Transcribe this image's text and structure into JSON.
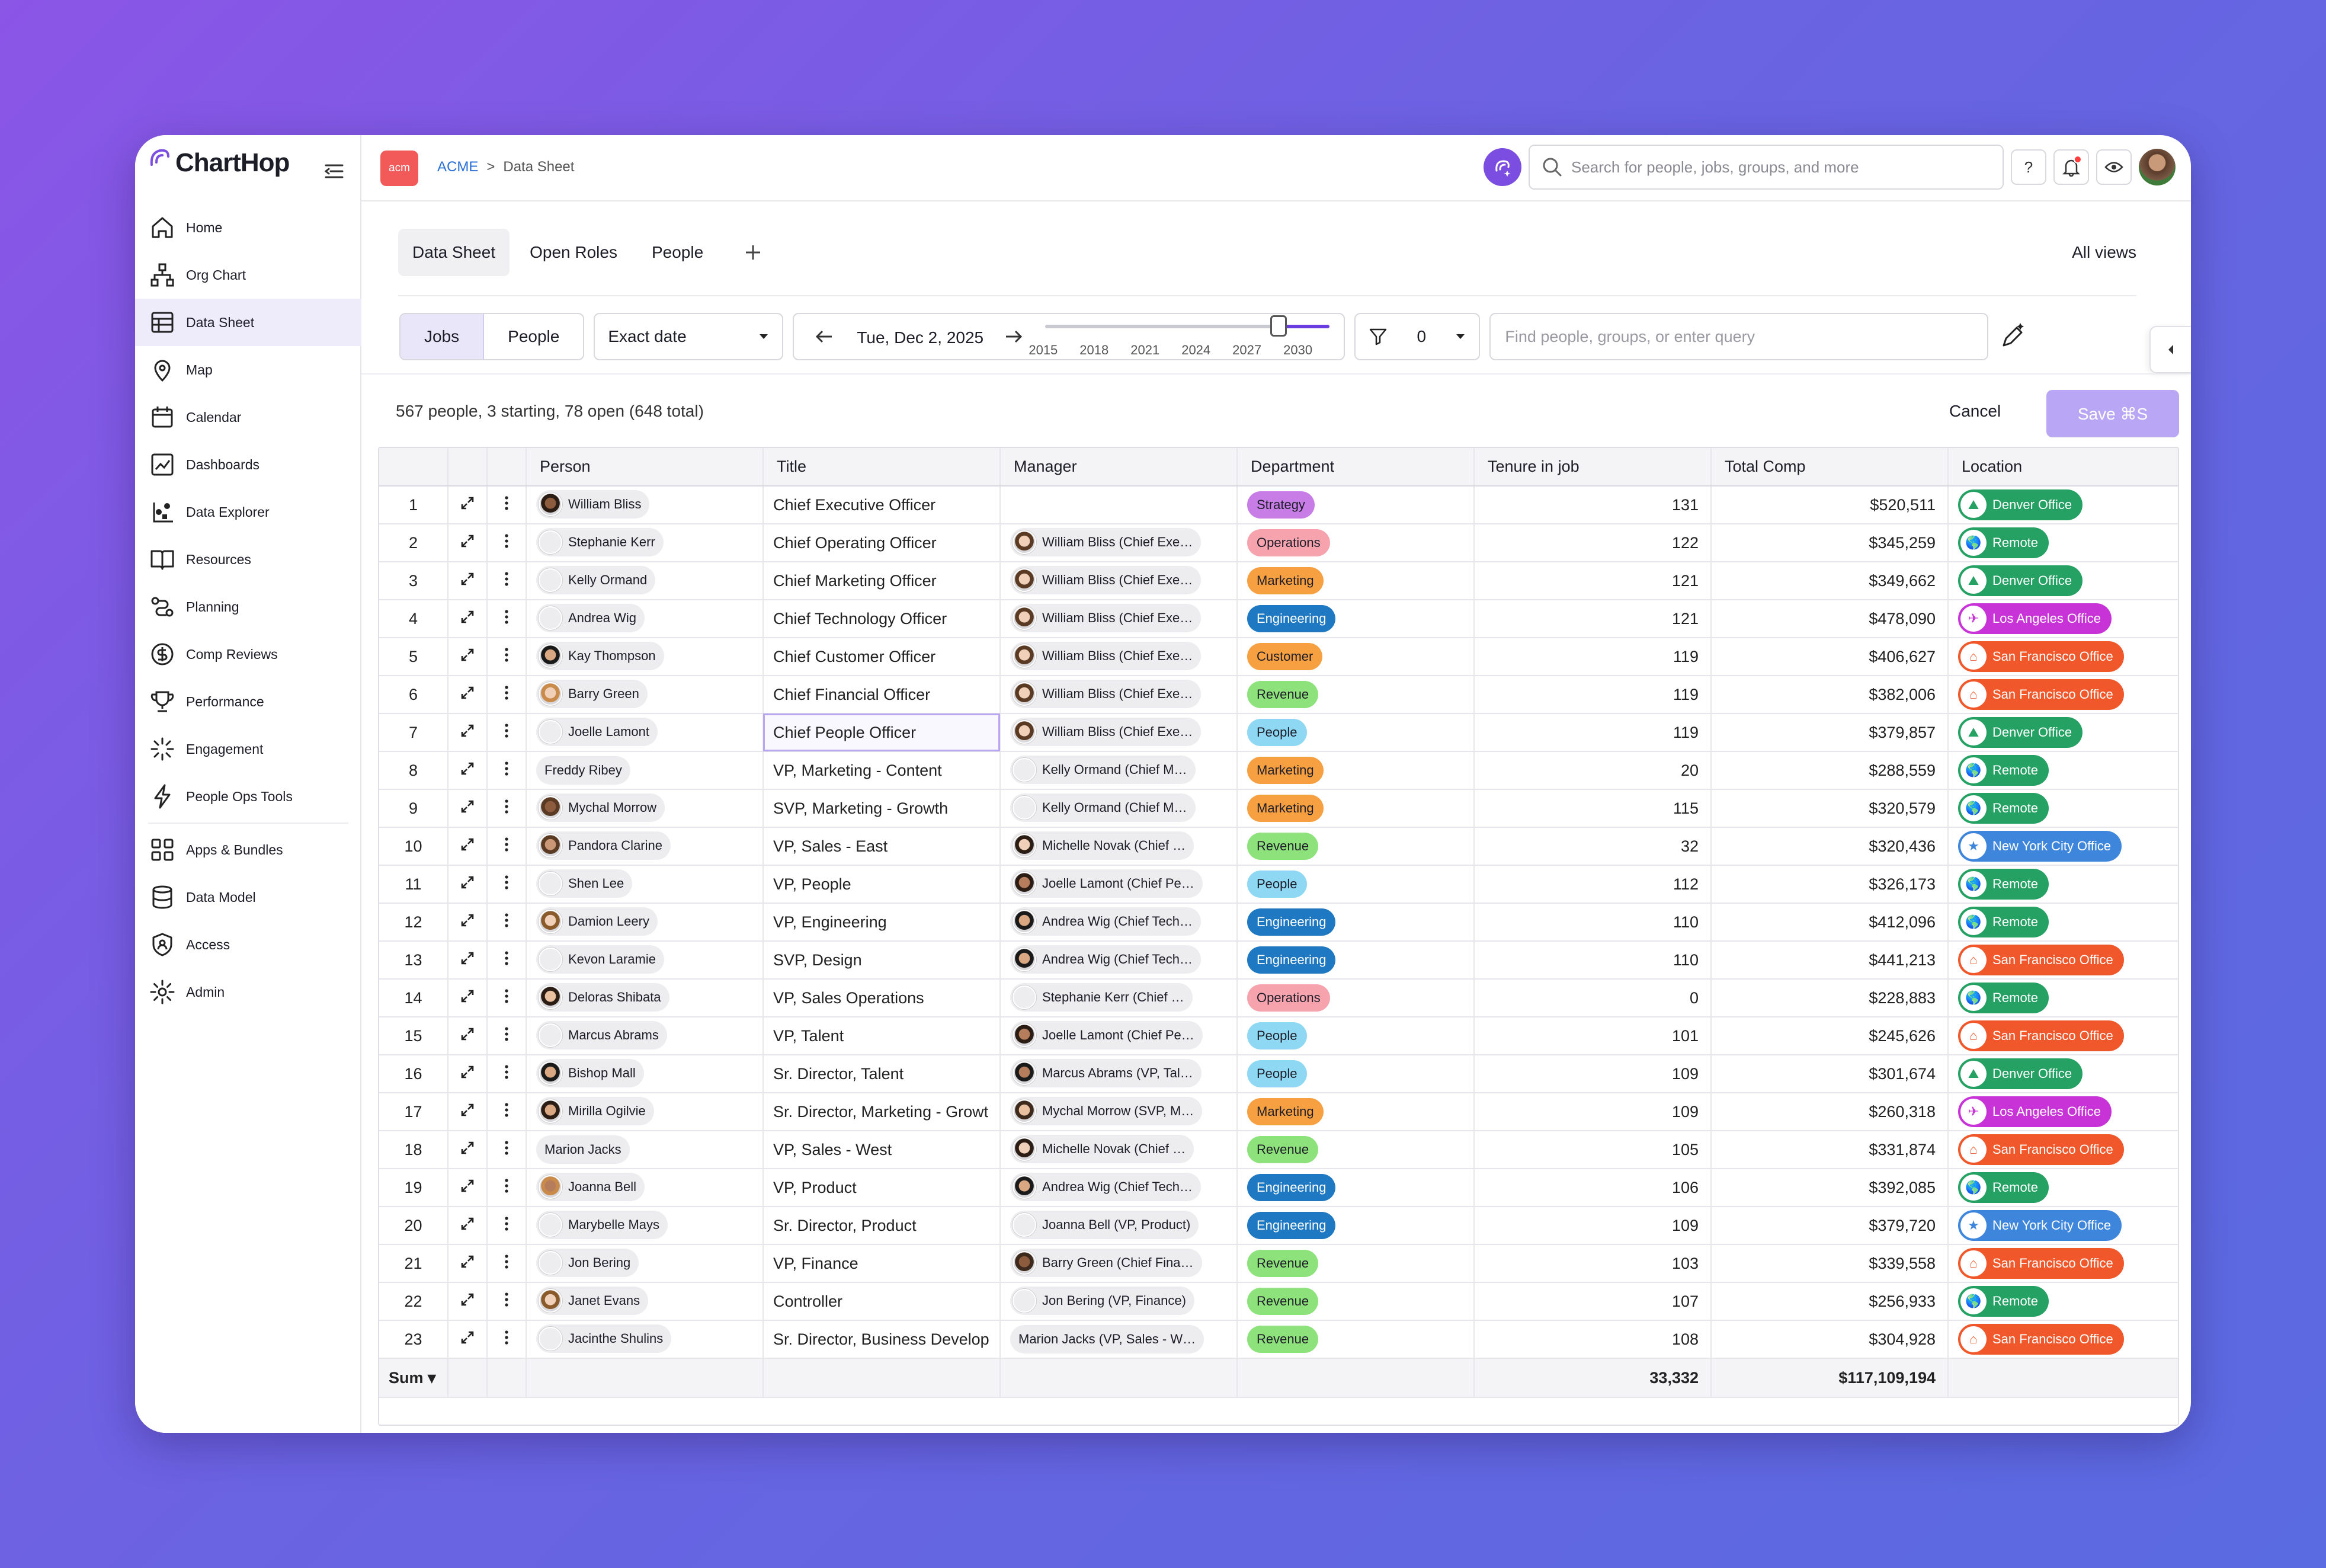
{
  "app": {
    "logo": "ChartHop"
  },
  "nav": [
    {
      "label": "Home",
      "icon": "home-icon"
    },
    {
      "label": "Org Chart",
      "icon": "org-chart-icon"
    },
    {
      "label": "Data Sheet",
      "icon": "table-icon",
      "active": true
    },
    {
      "label": "Map",
      "icon": "map-pin-icon"
    },
    {
      "label": "Calendar",
      "icon": "calendar-icon"
    },
    {
      "label": "Dashboards",
      "icon": "dashboard-icon"
    },
    {
      "label": "Data Explorer",
      "icon": "data-explorer-icon"
    },
    {
      "label": "Resources",
      "icon": "book-icon"
    },
    {
      "label": "Planning",
      "icon": "planning-icon"
    },
    {
      "label": "Comp Reviews",
      "icon": "dollar-icon"
    },
    {
      "label": "Performance",
      "icon": "trophy-icon"
    },
    {
      "label": "Engagement",
      "icon": "spark-icon"
    },
    {
      "label": "People Ops Tools",
      "icon": "bolt-icon"
    },
    {
      "label": "Apps & Bundles",
      "icon": "apps-icon"
    },
    {
      "label": "Data Model",
      "icon": "database-icon"
    },
    {
      "label": "Access",
      "icon": "shield-icon"
    },
    {
      "label": "Admin",
      "icon": "gear-icon"
    }
  ],
  "topbar": {
    "org_badge": "acm",
    "breadcrumb": [
      "ACME",
      ">",
      "Data Sheet"
    ],
    "search_placeholder": "Search for people, jobs, groups, and more",
    "help": "?"
  },
  "tabs": [
    "Data Sheet",
    "Open Roles",
    "People"
  ],
  "all_views": "All views",
  "filters": {
    "entity": [
      "Jobs",
      "People"
    ],
    "date_mode": "Exact date",
    "date": "Tue, Dec 2, 2025",
    "timeline_years": [
      "2015",
      "2018",
      "2021",
      "2024",
      "2027",
      "2030"
    ],
    "timeline_fraction": 0.82,
    "filter_count": "0",
    "query_placeholder": "Find people, groups, or enter query"
  },
  "summary": "567 people, 3 starting, 78 open (648 total)",
  "cancel": "Cancel",
  "save": "Save ⌘S",
  "columns": [
    "Person",
    "Title",
    "Manager",
    "Department",
    "Tenure in job",
    "Total Comp",
    "Location"
  ],
  "dept_colors": {
    "Strategy": "#c77ce6",
    "Operations": "#f6a3ad",
    "Marketing": "#f7a042",
    "Engineering": "#1f78c2",
    "Customer": "#f7a042",
    "Revenue": "#8ee27b",
    "People": "#8fd8f3"
  },
  "location_colors": {
    "Denver Office": "#25a163",
    "Remote": "#25a163",
    "Los Angeles Office": "#c733d6",
    "San Francisco Office": "#f0572a",
    "New York City Office": "#3e86dc"
  },
  "rows": [
    {
      "n": "1",
      "person": "William Bliss",
      "title": "Chief Executive Officer",
      "manager": "",
      "dept": "Strategy",
      "tenure": "131",
      "comp": "$520,511",
      "loc": "Denver Office"
    },
    {
      "n": "2",
      "person": "Stephanie Kerr",
      "title": "Chief Operating Officer",
      "manager": "William Bliss (Chief Exe…",
      "dept": "Operations",
      "tenure": "122",
      "comp": "$345,259",
      "loc": "Remote"
    },
    {
      "n": "3",
      "person": "Kelly Ormand",
      "title": "Chief Marketing Officer",
      "manager": "William Bliss (Chief Exe…",
      "dept": "Marketing",
      "tenure": "121",
      "comp": "$349,662",
      "loc": "Denver Office"
    },
    {
      "n": "4",
      "person": "Andrea Wig",
      "title": "Chief Technology Officer",
      "manager": "William Bliss (Chief Exe…",
      "dept": "Engineering",
      "tenure": "121",
      "comp": "$478,090",
      "loc": "Los Angeles Office"
    },
    {
      "n": "5",
      "person": "Kay Thompson",
      "title": "Chief Customer Officer",
      "manager": "William Bliss (Chief Exe…",
      "dept": "Customer",
      "tenure": "119",
      "comp": "$406,627",
      "loc": "San Francisco Office"
    },
    {
      "n": "6",
      "person": "Barry Green",
      "title": "Chief Financial Officer",
      "manager": "William Bliss (Chief Exe…",
      "dept": "Revenue",
      "tenure": "119",
      "comp": "$382,006",
      "loc": "San Francisco Office"
    },
    {
      "n": "7",
      "person": "Joelle Lamont",
      "title": "Chief People Officer",
      "manager": "William Bliss (Chief Exe…",
      "dept": "People",
      "tenure": "119",
      "comp": "$379,857",
      "loc": "Denver Office",
      "selected": true
    },
    {
      "n": "8",
      "person": "Freddy Ribey",
      "title": "VP, Marketing - Content",
      "manager": "Kelly Ormand (Chief M…",
      "dept": "Marketing",
      "tenure": "20",
      "comp": "$288,559",
      "loc": "Remote",
      "noavatar": true
    },
    {
      "n": "9",
      "person": "Mychal Morrow",
      "title": "SVP, Marketing - Growth",
      "manager": "Kelly Ormand (Chief M…",
      "dept": "Marketing",
      "tenure": "115",
      "comp": "$320,579",
      "loc": "Remote"
    },
    {
      "n": "10",
      "person": "Pandora Clarine",
      "title": "VP, Sales - East",
      "manager": "Michelle Novak (Chief …",
      "dept": "Revenue",
      "tenure": "32",
      "comp": "$320,436",
      "loc": "New York City Office"
    },
    {
      "n": "11",
      "person": "Shen Lee",
      "title": "VP, People",
      "manager": "Joelle Lamont (Chief Pe…",
      "dept": "People",
      "tenure": "112",
      "comp": "$326,173",
      "loc": "Remote"
    },
    {
      "n": "12",
      "person": "Damion Leery",
      "title": "VP, Engineering",
      "manager": "Andrea Wig (Chief Tech…",
      "dept": "Engineering",
      "tenure": "110",
      "comp": "$412,096",
      "loc": "Remote"
    },
    {
      "n": "13",
      "person": "Kevon Laramie",
      "title": "SVP, Design",
      "manager": "Andrea Wig (Chief Tech…",
      "dept": "Engineering",
      "tenure": "110",
      "comp": "$441,213",
      "loc": "San Francisco Office"
    },
    {
      "n": "14",
      "person": "Deloras Shibata",
      "title": "VP, Sales Operations",
      "manager": "Stephanie Kerr (Chief …",
      "dept": "Operations",
      "tenure": "0",
      "comp": "$228,883",
      "loc": "Remote"
    },
    {
      "n": "15",
      "person": "Marcus Abrams",
      "title": "VP, Talent",
      "manager": "Joelle Lamont (Chief Pe…",
      "dept": "People",
      "tenure": "101",
      "comp": "$245,626",
      "loc": "San Francisco Office"
    },
    {
      "n": "16",
      "person": "Bishop Mall",
      "title": "Sr. Director, Talent",
      "manager": "Marcus Abrams (VP, Tal…",
      "dept": "People",
      "tenure": "109",
      "comp": "$301,674",
      "loc": "Denver Office"
    },
    {
      "n": "17",
      "person": "Mirilla Ogilvie",
      "title": "Sr. Director, Marketing - Growt",
      "manager": "Mychal Morrow (SVP, M…",
      "dept": "Marketing",
      "tenure": "109",
      "comp": "$260,318",
      "loc": "Los Angeles Office"
    },
    {
      "n": "18",
      "person": "Marion Jacks",
      "title": "VP, Sales - West",
      "manager": "Michelle Novak (Chief …",
      "dept": "Revenue",
      "tenure": "105",
      "comp": "$331,874",
      "loc": "San Francisco Office",
      "noavatar": true
    },
    {
      "n": "19",
      "person": "Joanna Bell",
      "title": "VP, Product",
      "manager": "Andrea Wig (Chief Tech…",
      "dept": "Engineering",
      "tenure": "106",
      "comp": "$392,085",
      "loc": "Remote"
    },
    {
      "n": "20",
      "person": "Marybelle Mays",
      "title": "Sr. Director, Product",
      "manager": "Joanna Bell (VP, Product)",
      "dept": "Engineering",
      "tenure": "109",
      "comp": "$379,720",
      "loc": "New York City Office"
    },
    {
      "n": "21",
      "person": "Jon Bering",
      "title": "VP, Finance",
      "manager": "Barry Green (Chief Fina…",
      "dept": "Revenue",
      "tenure": "103",
      "comp": "$339,558",
      "loc": "San Francisco Office"
    },
    {
      "n": "22",
      "person": "Janet Evans",
      "title": "Controller",
      "manager": "Jon Bering (VP, Finance)",
      "dept": "Revenue",
      "tenure": "107",
      "comp": "$256,933",
      "loc": "Remote"
    },
    {
      "n": "23",
      "person": "Jacinthe Shulins",
      "title": "Sr. Director, Business Develop",
      "manager": "Marion Jacks (VP, Sales - W…",
      "dept": "Revenue",
      "tenure": "108",
      "comp": "$304,928",
      "loc": "San Francisco Office",
      "mgr_noavatar": true
    }
  ],
  "footer": {
    "label": "Sum ▾",
    "tenure_sum": "33,332",
    "comp_sum": "$117,109,194"
  }
}
